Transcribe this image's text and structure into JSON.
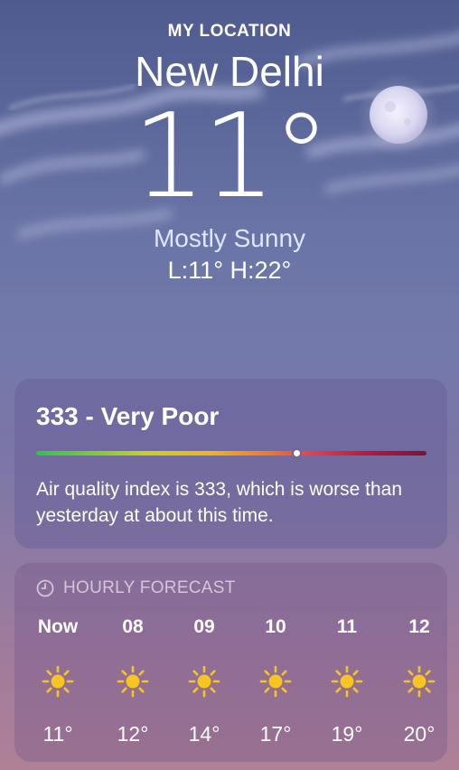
{
  "header": {
    "location_label": "MY LOCATION",
    "city": "New Delhi",
    "temperature": "11°",
    "condition": "Mostly Sunny",
    "low_high": "L:11° H:22°"
  },
  "aqi": {
    "title": "333 - Very Poor",
    "description": "Air quality index is 333, which is worse than yesterday at about this time.",
    "value": 333,
    "scale_position_fraction": 0.665
  },
  "hourly": {
    "heading": "HOURLY FORECAST",
    "items": [
      {
        "time": "Now",
        "icon": "sun-icon",
        "temp": "11°"
      },
      {
        "time": "08",
        "icon": "sun-icon",
        "temp": "12°"
      },
      {
        "time": "09",
        "icon": "sun-icon",
        "temp": "14°"
      },
      {
        "time": "10",
        "icon": "sun-icon",
        "temp": "17°"
      },
      {
        "time": "11",
        "icon": "sun-icon",
        "temp": "19°"
      },
      {
        "time": "12",
        "icon": "sun-icon",
        "temp": "20°"
      }
    ]
  },
  "colors": {
    "sun": "#f7c51e",
    "condition_text": "#dfe6ff"
  }
}
